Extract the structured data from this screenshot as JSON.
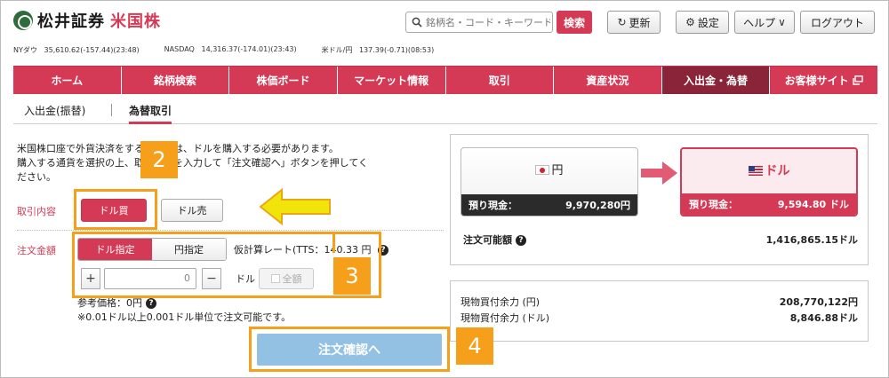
{
  "header": {
    "brand": "松井証券",
    "section": "米国株",
    "search_placeholder": "銘柄名・コード・キーワード",
    "search_button": "検索",
    "refresh_label": "更新",
    "settings_label": "設定",
    "help_label": "ヘルプ",
    "logout_label": "ログアウト"
  },
  "ticker": [
    {
      "label": "NYダウ",
      "value": "35,610.62(-157.44)(23:48)"
    },
    {
      "label": "NASDAQ",
      "value": "14,316.37(-174.01)(23:43)"
    },
    {
      "label": "米ドル/円",
      "value": "137.39(-0.71)(08:53)"
    }
  ],
  "nav": {
    "items": [
      "ホーム",
      "銘柄検索",
      "株価ボード",
      "マーケット情報",
      "取引",
      "資産状況",
      "入出金・為替",
      "お客様サイト"
    ],
    "active_index": 6
  },
  "subtabs": {
    "items": [
      "入出金(振替)",
      "為替取引"
    ],
    "active_index": 1
  },
  "form": {
    "description_line1": "米国株口座で外貨決済をするためには、ドルを購入する必要があります。",
    "description_line2": "購入する通貨を選択の上、取引内容を入力して「注文確認へ」ボタンを押してく",
    "description_line3": "ださい。",
    "trade_type_label": "取引内容",
    "buy_label": "ドル買",
    "sell_label": "ドル売",
    "order_amount_label": "注文金額",
    "dollar_mode_label": "ドル指定",
    "yen_mode_label": "円指定",
    "rate_text": "仮計算レート(TTS：140.33 円",
    "amount_value": "0",
    "unit_label": "ドル",
    "all_label": "全額",
    "reference_price": "参考価格：0円",
    "note": "※0.01ドル以上0.001ドル単位で注文可能です。",
    "submit_label": "注文確認へ"
  },
  "annotations": {
    "step2": "2",
    "step3": "3",
    "step4": "4",
    "highlight_color": "#f59f1a",
    "arrow_color": "#f2e40a"
  },
  "balances": {
    "jpy": {
      "currency": "円",
      "deposit_label": "預り現金：",
      "deposit_value": "9,970,280円"
    },
    "usd": {
      "currency": "ドル",
      "deposit_label": "預り現金：",
      "deposit_value": "9,594.80 ドル"
    },
    "available_label": "注文可能額",
    "available_value": "1,416,865.15ドル",
    "spot_yen_label": "現物買付余力 (円)",
    "spot_yen_value": "208,770,122円",
    "spot_usd_label": "現物買付余力 (ドル)",
    "spot_usd_value": "8,846.88ドル"
  },
  "colors": {
    "brand": "#d43a55",
    "nav_active": "#8a2439",
    "submit": "#93c1e3"
  }
}
